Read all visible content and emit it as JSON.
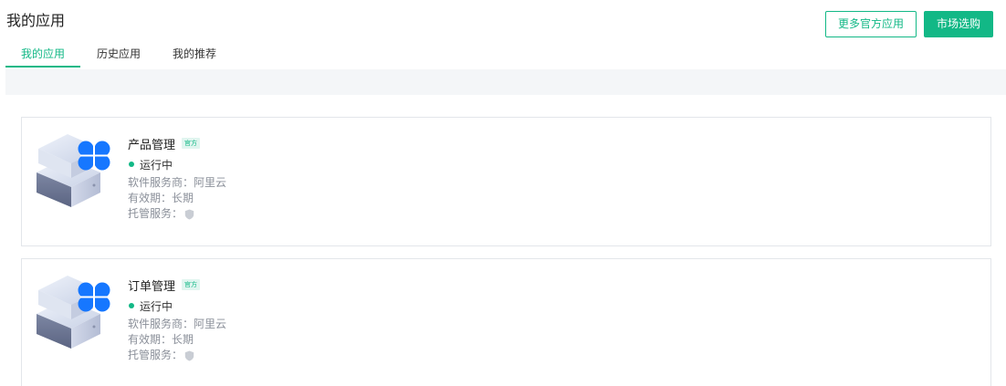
{
  "header": {
    "title": "我的应用",
    "more_button": "更多官方应用",
    "buy_button": "市场选购"
  },
  "tabs": [
    {
      "label": "我的应用",
      "active": true
    },
    {
      "label": "历史应用",
      "active": false
    },
    {
      "label": "我的推荐",
      "active": false
    }
  ],
  "apps": [
    {
      "name": "产品管理",
      "badge": "官方",
      "status": "运行中",
      "vendor": "软件服务商：阿里云",
      "validity": "有效期：长期",
      "hosting_label": "托管服务：",
      "hosting_icon": "shield-icon"
    },
    {
      "name": "订单管理",
      "badge": "官方",
      "status": "运行中",
      "vendor": "软件服务商：阿里云",
      "validity": "有效期：长期",
      "hosting_label": "托管服务：",
      "hosting_icon": "shield-icon"
    }
  ],
  "colors": {
    "accent": "#12b886",
    "badge_bg": "#e0f5ef",
    "status_running": "#12b886",
    "icon_blue": "#1677ff"
  }
}
